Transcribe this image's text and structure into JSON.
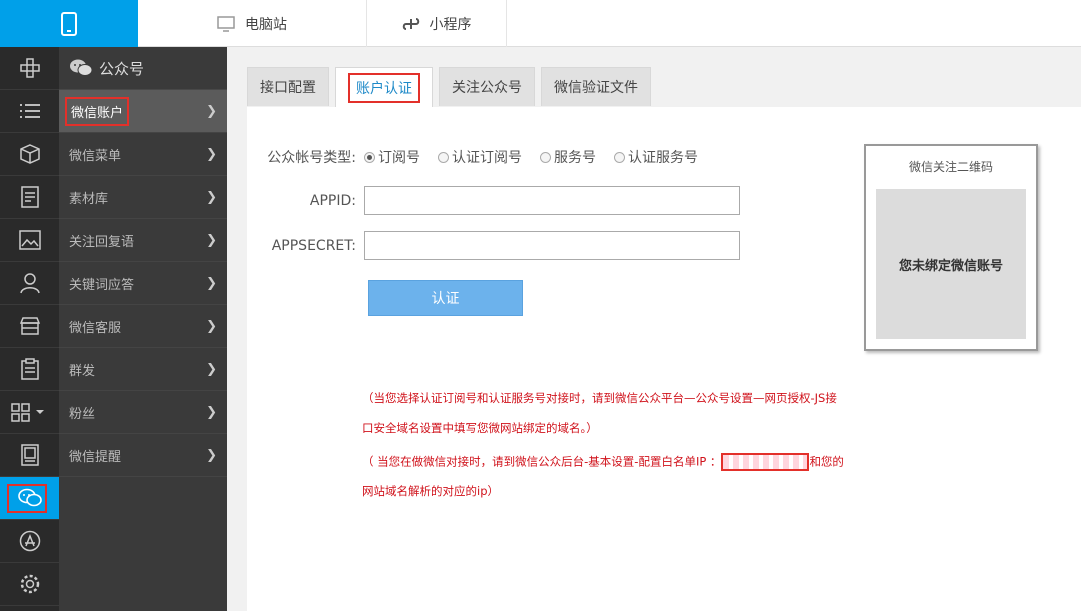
{
  "topbar": {
    "tabs": [
      {
        "label": "电脑站",
        "icon": "monitor-icon"
      },
      {
        "label": "小程序",
        "icon": "mini-program-icon"
      }
    ],
    "mobile_icon": "mobile-phone-icon"
  },
  "rail": {
    "icons": [
      "ui-builder-icon",
      "list-icon",
      "box-icon",
      "document-icon",
      "image-icon",
      "user-icon",
      "store-icon",
      "clipboard-icon",
      "grid-icon",
      "picture-frame-icon",
      "wechat-icon",
      "app-store-icon",
      "gear-icon"
    ]
  },
  "submenu": {
    "title": "公众号",
    "items": [
      {
        "label": "微信账户"
      },
      {
        "label": "微信菜单"
      },
      {
        "label": "素材库"
      },
      {
        "label": "关注回复语"
      },
      {
        "label": "关键词应答"
      },
      {
        "label": "微信客服"
      },
      {
        "label": "群发"
      },
      {
        "label": "粉丝"
      },
      {
        "label": "微信提醒"
      }
    ]
  },
  "tabs": [
    {
      "label": "接口配置"
    },
    {
      "label": "账户认证"
    },
    {
      "label": "关注公众号"
    },
    {
      "label": "微信验证文件"
    }
  ],
  "form": {
    "type_label": "公众帐号类型:",
    "radios": [
      "订阅号",
      "认证订阅号",
      "服务号",
      "认证服务号"
    ],
    "selected": "订阅号",
    "appid_label": "APPID:",
    "appid_value": "",
    "appsecret_label": "APPSECRET:",
    "appsecret_value": "",
    "submit_label": "认证"
  },
  "qr": {
    "title": "微信关注二维码",
    "placeholder": "您未绑定微信账号"
  },
  "notes": {
    "line1": "（当您选择认证订阅号和认证服务号对接时，请到微信公众平台—公众号设置—网页授权-JS接",
    "line2": "口安全域名设置中填写您微网站绑定的域名。）",
    "line3a": "（ 当您在做微信对接时，请到微信公众后台-基本设置-配置白名单IP ：",
    "line3b": "和您的",
    "line4": "网站域名解析的对应的ip）"
  }
}
